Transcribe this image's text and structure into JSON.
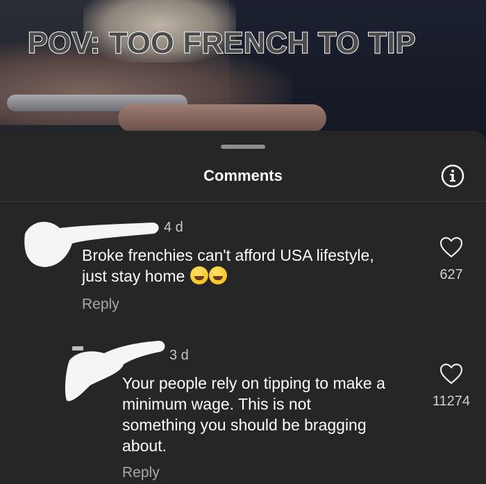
{
  "video": {
    "caption": "POV: TOO FRENCH TO TIP"
  },
  "sheet": {
    "title": "Comments",
    "info_icon": "info-circle-icon"
  },
  "comments": [
    {
      "time": "4 d",
      "text_line1": "Broke frenchies can't afford USA lifestyle,",
      "text_line2": "just stay home",
      "emoji": "😂😂",
      "reply_label": "Reply",
      "likes": "627",
      "like_icon": "heart-icon"
    },
    {
      "time": "3 d",
      "text_line1": "Your people rely on tipping to make a",
      "text_line2": "minimum wage. This is not",
      "text_line3": "something you should be bragging",
      "text_line4": "about.",
      "reply_label": "Reply",
      "likes": "11274",
      "like_icon": "heart-icon"
    }
  ],
  "colors": {
    "sheet_bg": "#262626",
    "text_primary": "#ffffff",
    "text_secondary": "#a8a8a8"
  }
}
